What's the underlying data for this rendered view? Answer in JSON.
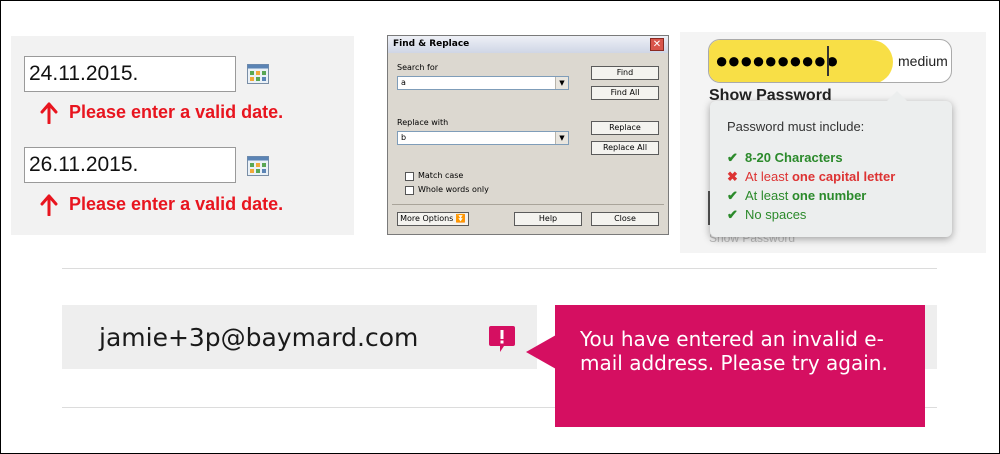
{
  "date_fields": [
    {
      "value": "24.11.2015.",
      "error": "Please enter a valid date."
    },
    {
      "value": "26.11.2015.",
      "error": "Please enter a valid date."
    }
  ],
  "find_replace": {
    "title": "Find & Replace",
    "search_label": "Search for",
    "search_value": "a",
    "replace_label": "Replace with",
    "replace_value": "b",
    "find_btn": "Find",
    "find_all_btn": "Find All",
    "replace_btn": "Replace",
    "replace_all_btn": "Replace All",
    "match_case": "Match case",
    "whole_words": "Whole words only",
    "more_options": "More Options",
    "help_btn": "Help",
    "close_btn": "Close",
    "close_glyph": "✕"
  },
  "password": {
    "dots": "●●●●●●●●●●",
    "strength": "medium",
    "strength_fraction": 0.76,
    "show_label": "Show Password",
    "tip_title": "Password must include:",
    "rules": [
      {
        "status": "ok",
        "prefix": "",
        "bold": "8-20 Characters"
      },
      {
        "status": "bad",
        "prefix": "At least ",
        "bold": "one capital letter"
      },
      {
        "status": "ok",
        "prefix": "At least ",
        "bold": "one number"
      },
      {
        "status": "ok",
        "prefix": "No spaces",
        "bold": ""
      }
    ],
    "under_text": "Show Password"
  },
  "email": {
    "value": "jamie+3p@baymard.com",
    "error": "You have entered an invalid e-mail address. Please try again."
  },
  "colors": {
    "error_red": "#e8151f",
    "strength_yellow": "#f8df46",
    "callout_pink": "#d50f61"
  }
}
